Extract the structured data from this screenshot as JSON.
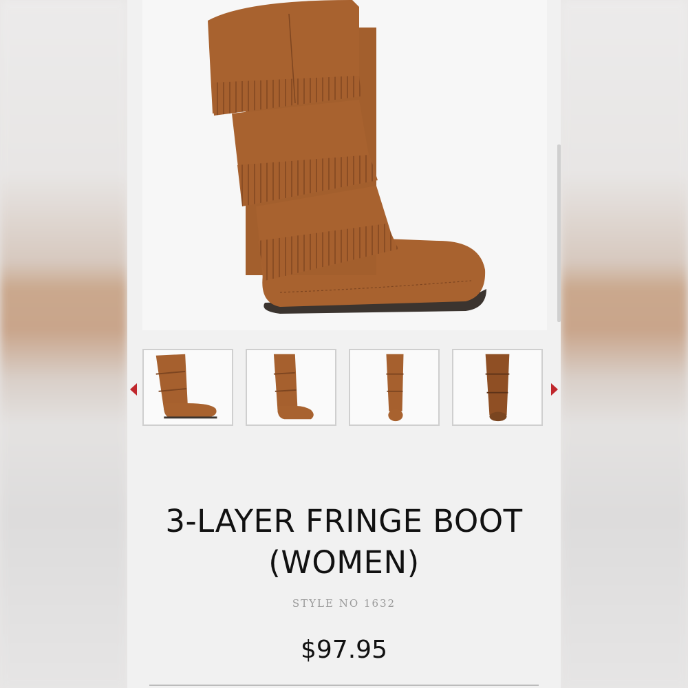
{
  "product": {
    "title_line1": "3-LAYER FRINGE BOOT",
    "title_line2": "(WOMEN)",
    "style_no": "STYLE NO 1632",
    "price": "$97.95"
  },
  "gallery": {
    "main_image": "boot-side-view",
    "thumbnails": [
      "boot-side-view",
      "boot-angle-view",
      "boot-front-view",
      "boot-back-view"
    ]
  },
  "colors": {
    "accent_arrow": "#c0272d",
    "boot_brown": "#a8622f"
  }
}
